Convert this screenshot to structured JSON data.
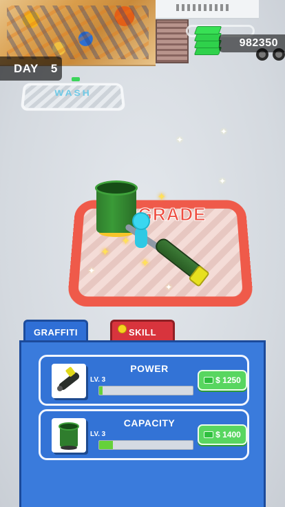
{
  "hud": {
    "cash": "982350",
    "day_label": "DAY",
    "day_number": "5"
  },
  "world": {
    "wash_label": "WASH",
    "upgrade_label": "UPGRADE"
  },
  "tabs": [
    {
      "label": "GRAFFITI",
      "active": true,
      "color": "#2f6fd6"
    },
    {
      "label": "SKILL",
      "active": false,
      "color": "#d8343d"
    }
  ],
  "upgrades": [
    {
      "title": "POWER",
      "level": "LV. 3",
      "progress_fraction": 0.04,
      "price": "$ 1250",
      "icon": "spray-gun-icon"
    },
    {
      "title": "CAPACITY",
      "level": "LV. 3",
      "progress_fraction": 0.15,
      "price": "$ 1400",
      "icon": "paint-bin-icon"
    }
  ],
  "colors": {
    "panel": "#3a7bdc",
    "buy_button": "#58d660",
    "upgrade_zone": "#ef5a4a"
  }
}
